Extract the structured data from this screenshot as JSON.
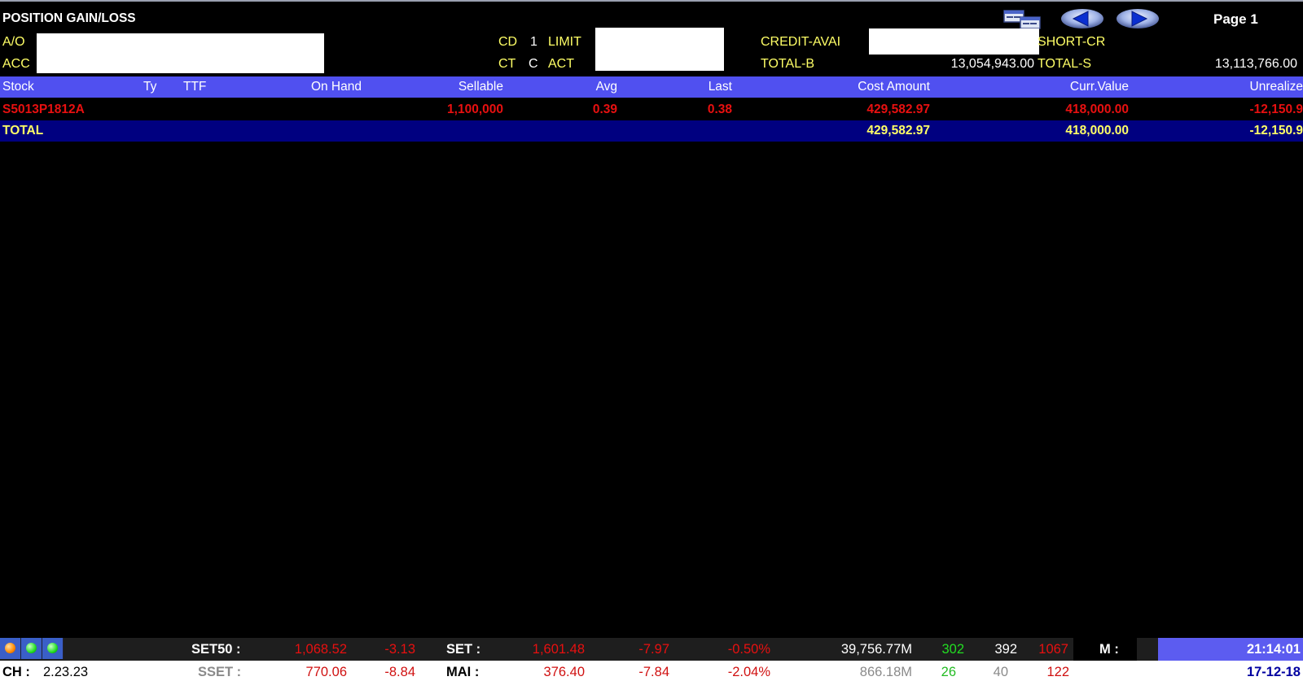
{
  "header": {
    "title": "POSITION GAIN/LOSS",
    "page_label": "Page 1",
    "ao_label": "A/O",
    "acc_label": "ACC",
    "cd_label": "CD",
    "cd_value": "1",
    "limit_label": "LIMIT",
    "ct_label": "CT",
    "ct_value": "C",
    "act_label": "ACT",
    "credit_avai_label": "CREDIT-AVAI",
    "short_cr_label": "SHORT-CR",
    "total_b_label": "TOTAL-B",
    "total_b_value": "13,054,943.00",
    "total_s_label": "TOTAL-S",
    "total_s_value": "13,113,766.00",
    "icons": [
      "copy-windows-icon",
      "prev-arrow-icon",
      "next-arrow-icon"
    ]
  },
  "table": {
    "columns": [
      "Stock",
      "Ty",
      "TTF",
      "On Hand",
      "Sellable",
      "Avg",
      "Last",
      "Cost Amount",
      "Curr.Value",
      "Unrealize"
    ],
    "rows": [
      {
        "stock": "S5013P1812A",
        "ty": "",
        "ttf": "",
        "on_hand": "",
        "sellable": "1,100,000",
        "avg": "0.39",
        "last": "0.38",
        "cost_amount": "429,582.97",
        "curr_value": "418,000.00",
        "unrealize": "-12,150.9"
      }
    ],
    "total": {
      "label": "TOTAL",
      "cost_amount": "429,582.97",
      "curr_value": "418,000.00",
      "unrealize": "-12,150.9"
    }
  },
  "footer": {
    "status_dots": [
      "orange",
      "green",
      "green"
    ],
    "set50_label": "SET50 :",
    "set50_value": "1,068.52",
    "set50_change": "-3.13",
    "set_label": "SET :",
    "set_value": "1,601.48",
    "set_change": "-7.97",
    "set_pct": "-0.50%",
    "set_volume": "39,756.77M",
    "set_up": "302",
    "set_unch": "392",
    "set_down": "1067",
    "m_label": "M :",
    "time": "21:14:01",
    "ch_label": "CH :",
    "ch_value": "2.23.23",
    "sset_label": "SSET :",
    "sset_value": "770.06",
    "sset_change": "-8.84",
    "mai_label": "MAI :",
    "mai_value": "376.40",
    "mai_change": "-7.84",
    "mai_pct": "-2.04%",
    "mai_volume": "866.18M",
    "mai_up": "26",
    "mai_unch": "40",
    "mai_down": "122",
    "date": "17-12-18"
  },
  "colors": {
    "background": "#000000",
    "header_bar": "#5050f0",
    "total_row": "#000080",
    "label_yellow": "#ffff66",
    "negative_red": "#e81010",
    "up_green": "#22dd22",
    "time_box": "#5c5cf0"
  }
}
